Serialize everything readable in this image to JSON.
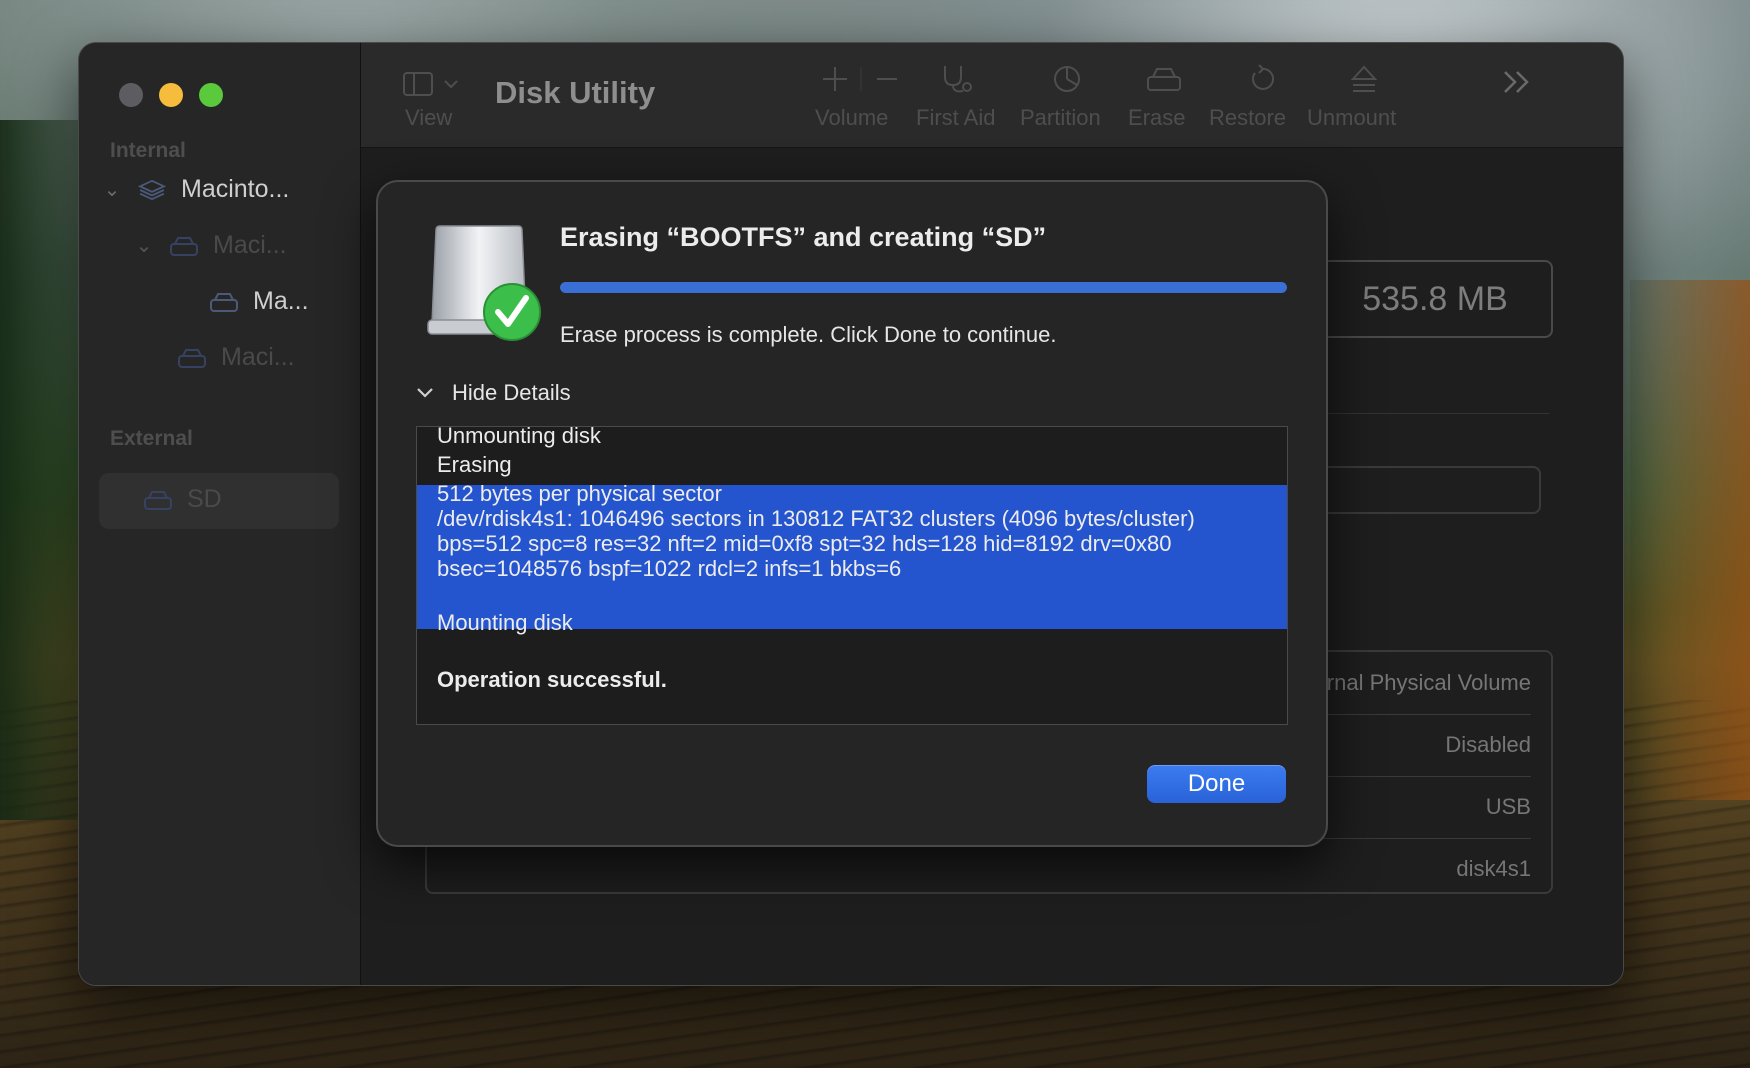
{
  "window": {
    "title": "Disk Utility"
  },
  "toolbar": {
    "view_label": "View",
    "volume_label": "Volume",
    "firstaid_label": "First Aid",
    "partition_label": "Partition",
    "erase_label": "Erase",
    "restore_label": "Restore",
    "unmount_label": "Unmount",
    "more_icon": "chevron-double-right-icon"
  },
  "sidebar": {
    "internal_label": "Internal",
    "external_label": "External",
    "items": [
      {
        "label": "Macinto...",
        "icon": "layers-icon",
        "state": "normal"
      },
      {
        "label": "Maci...",
        "icon": "disk-icon",
        "state": "dim"
      },
      {
        "label": "Ma...",
        "icon": "disk-icon",
        "state": "normal"
      },
      {
        "label": "Maci...",
        "icon": "disk-icon",
        "state": "dim"
      },
      {
        "label": "SD",
        "icon": "disk-icon",
        "state": "selected"
      }
    ]
  },
  "detail": {
    "capacity": "535.8 MB",
    "info_rows": [
      "rnal Physical Volume",
      "Disabled",
      "USB",
      "disk4s1"
    ]
  },
  "sheet": {
    "title": "Erasing “BOOTFS” and creating “SD”",
    "progress_fraction": 1.0,
    "message": "Erase process is complete. Click Done to continue.",
    "details_toggle": "Hide Details",
    "log": [
      "Unmounting disk",
      "Erasing",
      "512 bytes per physical sector",
      "/dev/rdisk4s1: 1046496 sectors in 130812 FAT32 clusters (4096 bytes/cluster)",
      "bps=512 spc=8 res=32 nft=2 mid=0xf8 spt=32 hds=128 hid=8192 drv=0x80",
      "bsec=1048576 bspf=1022 rdcl=2 infs=1 bkbs=6",
      "Mounting disk",
      "Operation successful."
    ],
    "done_label": "Done",
    "icon": "disk-checkmark-icon"
  },
  "colors": {
    "accent": "#2455cf",
    "progress": "#3a6fd6",
    "success_green": "#3cbf4a"
  }
}
